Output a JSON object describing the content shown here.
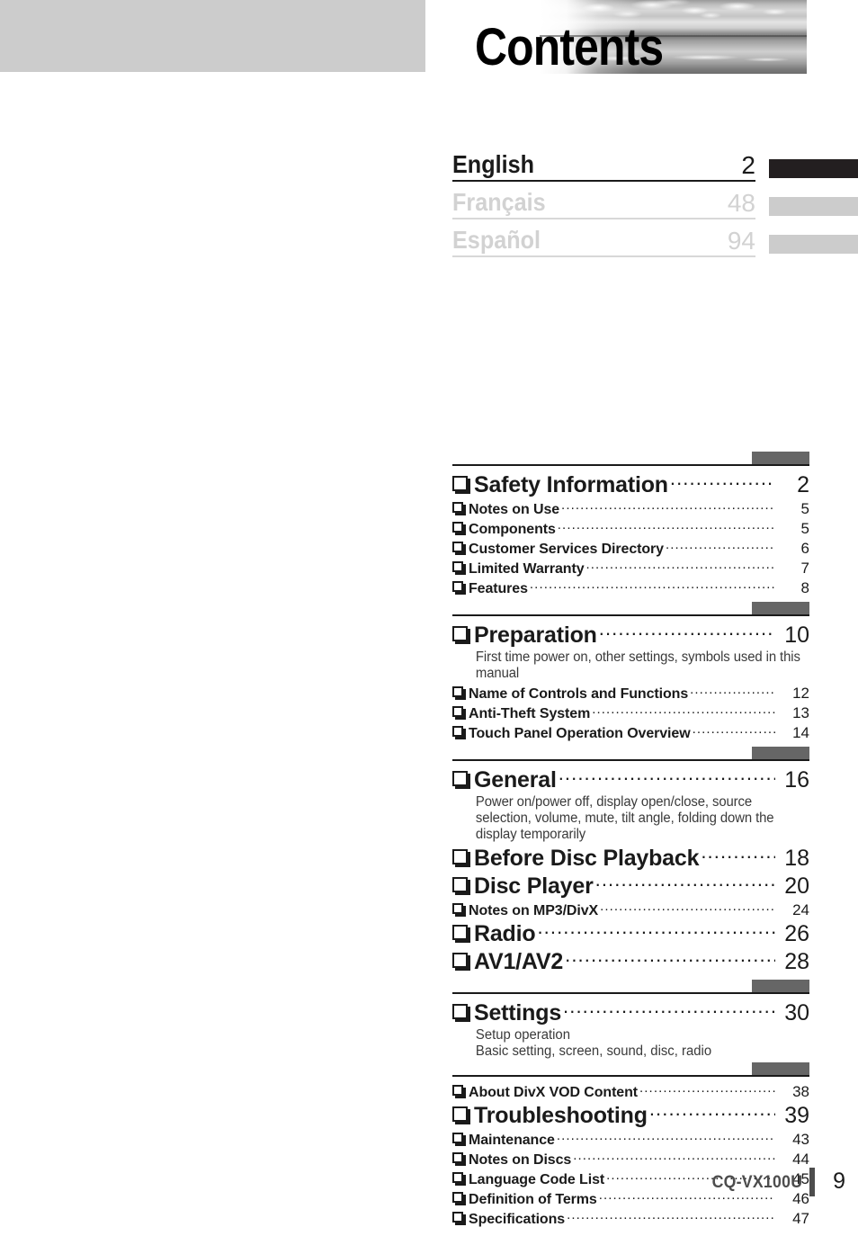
{
  "header": {
    "title": "Contents",
    "photo_alt": "seascape-photo"
  },
  "languages": [
    {
      "name": "English",
      "page": "2",
      "state": "active"
    },
    {
      "name": "Français",
      "page": "48",
      "state": "inactive"
    },
    {
      "name": "Español",
      "page": "94",
      "state": "inactive"
    }
  ],
  "toc": {
    "sections": [
      {
        "entries": [
          {
            "level": "major",
            "label": "Safety Information",
            "page": "2"
          },
          {
            "level": "minor",
            "label": "Notes on Use",
            "page": "5"
          },
          {
            "level": "minor",
            "label": "Components",
            "page": "5"
          },
          {
            "level": "minor",
            "label": "Customer Services Directory",
            "page": "6"
          },
          {
            "level": "minor",
            "label": "Limited Warranty",
            "page": "7"
          },
          {
            "level": "minor",
            "label": "Features",
            "page": "8"
          }
        ]
      },
      {
        "entries": [
          {
            "level": "major",
            "label": "Preparation",
            "page": "10",
            "note": "First time power on, other settings, symbols used in this manual"
          },
          {
            "level": "minor",
            "label": "Name of Controls and Functions",
            "page": "12"
          },
          {
            "level": "minor",
            "label": "Anti-Theft System",
            "page": "13"
          },
          {
            "level": "minor",
            "label": "Touch Panel Operation Overview",
            "page": "14"
          }
        ]
      },
      {
        "entries": [
          {
            "level": "major",
            "label": "General",
            "page": "16",
            "note": "Power on/power off, display open/close, source selection, volume, mute, tilt angle, folding down the display temporarily"
          },
          {
            "level": "major",
            "label": "Before Disc Playback",
            "page": "18"
          },
          {
            "level": "major",
            "label": "Disc Player",
            "page": "20"
          },
          {
            "level": "minor",
            "label": "Notes on MP3/DivX",
            "page": "24"
          },
          {
            "level": "major",
            "label": "Radio",
            "page": "26"
          },
          {
            "level": "major",
            "label": "AV1/AV2",
            "page": "28"
          }
        ]
      },
      {
        "entries": [
          {
            "level": "major",
            "label": "Settings",
            "page": "30",
            "note": "Setup operation\nBasic setting, screen, sound, disc, radio"
          }
        ]
      },
      {
        "entries": [
          {
            "level": "minor",
            "label": "About DivX VOD Content",
            "page": "38"
          },
          {
            "level": "major",
            "label": "Troubleshooting",
            "page": "39"
          },
          {
            "level": "minor",
            "label": "Maintenance",
            "page": "43"
          },
          {
            "level": "minor",
            "label": "Notes on Discs",
            "page": "44"
          },
          {
            "level": "minor",
            "label": "Language Code List",
            "page": "45"
          },
          {
            "level": "minor",
            "label": "Definition of Terms",
            "page": "46"
          },
          {
            "level": "minor",
            "label": "Specifications",
            "page": "47"
          }
        ]
      }
    ]
  },
  "footer": {
    "model": "CQ-VX100U",
    "page_number": "9"
  },
  "colors": {
    "header_band": "#cccccc",
    "active_tab": "#231f20",
    "inactive_tab": "#cccccc",
    "section_tab": "#666666",
    "rule": "#1a1a1a",
    "footer_text": "#4d4d4d"
  }
}
